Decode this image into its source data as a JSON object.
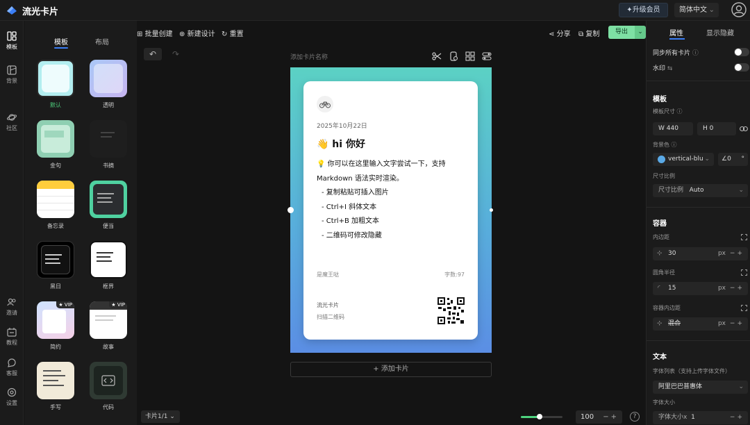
{
  "app": {
    "title": "流光卡片"
  },
  "topbar": {
    "upgrade": "升级会员",
    "language": "简体中文"
  },
  "left_rail": [
    {
      "label": "模板",
      "icon": "template-icon"
    },
    {
      "label": "背景",
      "icon": "background-icon"
    },
    {
      "label": "社区",
      "icon": "planet-icon"
    },
    {
      "label": "邀请",
      "icon": "invite-icon"
    },
    {
      "label": "教程",
      "icon": "tutorial-icon"
    },
    {
      "label": "客服",
      "icon": "support-icon"
    },
    {
      "label": "设置",
      "icon": "settings-icon"
    }
  ],
  "template_panel": {
    "tabs": [
      "模板",
      "布局"
    ],
    "templates": [
      {
        "label": "默认",
        "selected": true,
        "vip": false
      },
      {
        "label": "透明",
        "selected": false,
        "vip": false
      },
      {
        "label": "金句",
        "selected": false,
        "vip": false
      },
      {
        "label": "书摘",
        "selected": false,
        "vip": false
      },
      {
        "label": "备忘录",
        "selected": false,
        "vip": false
      },
      {
        "label": "便当",
        "selected": false,
        "vip": false
      },
      {
        "label": "黑日",
        "selected": false,
        "vip": false
      },
      {
        "label": "框界",
        "selected": false,
        "vip": false
      },
      {
        "label": "简约",
        "selected": false,
        "vip": true
      },
      {
        "label": "故事",
        "selected": false,
        "vip": true
      },
      {
        "label": "手写",
        "selected": false,
        "vip": false
      },
      {
        "label": "代码",
        "selected": false,
        "vip": false
      }
    ],
    "vip_badge": "VIP",
    "card_pager": "卡片1/1"
  },
  "toolbar": {
    "batch_create": "批量创建",
    "new_design": "新建设计",
    "reset": "重置",
    "share": "分享",
    "copy": "复制",
    "export": "导出"
  },
  "canvas": {
    "card_name_placeholder": "添加卡片名称",
    "add_card": "添加卡片",
    "zoom": "100",
    "zoom_fraction": 0.45
  },
  "card": {
    "date": "2025年10月22日",
    "heading": "👋 hi 你好",
    "body_line1": "💡 你可以在这里输入文字尝试一下，支持",
    "body_line2": "Markdown 语法实时渲染。",
    "bullets": [
      "- 复制粘贴可插入图片",
      "- Ctrl+I 斜体文本",
      "- Ctrl+B 加粗文本",
      "- 二维码可修改隐藏"
    ],
    "author": "是魔王哒",
    "word_count": "字数:97",
    "brand": "流光卡片",
    "scan_hint": "扫描二维码"
  },
  "right_panel": {
    "tabs": [
      "属性",
      "显示隐藏"
    ],
    "sync_all": "同步所有卡片",
    "watermark": "水印",
    "template_section": "模板",
    "template_size": "模板尺寸",
    "width": "W 440",
    "height": "H 0",
    "bg_color": "背景色",
    "bg_value": "vertical-blu",
    "angle": "0",
    "angle_unit": "°",
    "ratio_label": "尺寸比例",
    "ratio_prefix": "尺寸比例",
    "ratio_value": "Auto",
    "container_section": "容器",
    "padding_label": "内边距",
    "padding_value": "30",
    "radius_label": "圆角半径",
    "radius_value": "15",
    "inner_padding_label": "容器内边距",
    "inner_padding_value": "混合",
    "unit": "px",
    "text_section": "文本",
    "font_list_label": "字体列表（支持上传字体文件）",
    "font_value": "阿里巴巴普惠体",
    "font_size_label": "字体大小",
    "font_size_prefix": "字体大小x",
    "font_size_value": "1"
  },
  "colors": {
    "accent": "#7ee0a4",
    "tab_underline": "#3b7ef6",
    "canvas_top": "#5bd1c4",
    "canvas_bottom": "#5b8ee4"
  }
}
